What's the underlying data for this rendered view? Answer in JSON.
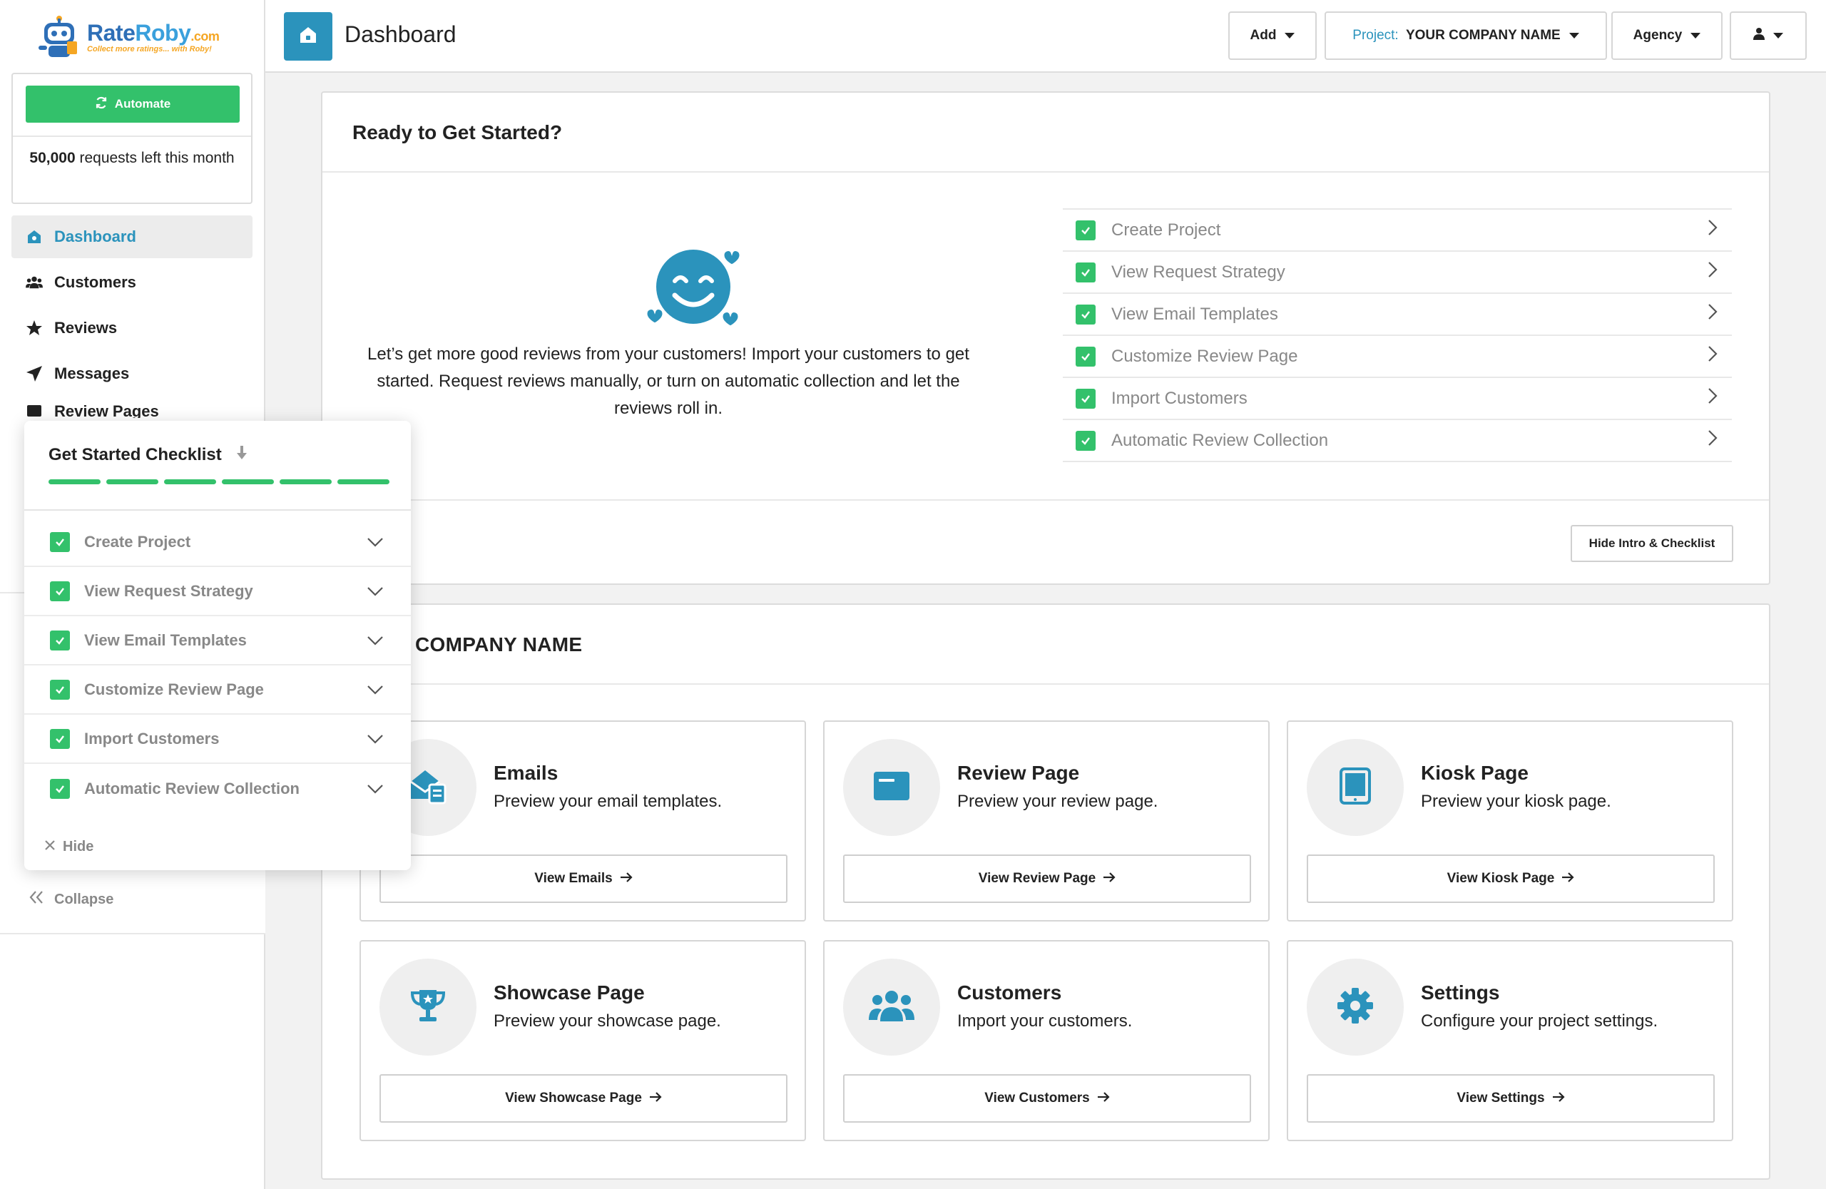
{
  "brand": {
    "name_part1": "Rate",
    "name_part2": "Roby",
    "name_suffix": ".com",
    "tagline": "Collect more ratings... with Roby!"
  },
  "automate": {
    "button_label": "Automate",
    "requests_count": "50,000",
    "requests_text": " requests left this month"
  },
  "sidebar": {
    "items": [
      {
        "label": "Dashboard",
        "icon": "home-icon",
        "active": true
      },
      {
        "label": "Customers",
        "icon": "users-icon"
      },
      {
        "label": "Reviews",
        "icon": "star-icon"
      },
      {
        "label": "Messages",
        "icon": "paper-plane-icon"
      },
      {
        "label": "Review Pages",
        "icon": "pages-icon"
      }
    ],
    "collapse_label": "Collapse"
  },
  "header": {
    "title": "Dashboard",
    "add_label": "Add",
    "project_prefix": "Project:",
    "project_name": "YOUR COMPANY NAME",
    "agency_label": "Agency"
  },
  "intro": {
    "title": "Ready to Get Started?",
    "body": "Let’s get more good reviews from your customers! Import your customers to get started. Request reviews manually, or turn on automatic collection and let the reviews roll in.",
    "checklist": [
      "Create Project",
      "View Request Strategy",
      "View Email Templates",
      "Customize Review Page",
      "Import Customers",
      "Automatic Review Collection"
    ],
    "hide_button": "Hide Intro & Checklist"
  },
  "project": {
    "title_visible": "COMPANY NAME",
    "features": [
      {
        "title": "Emails",
        "desc": "Preview your email templates.",
        "button": "View Emails",
        "icon": "envelope-icon"
      },
      {
        "title": "Review Page",
        "desc": "Preview your review page.",
        "button": "View Review Page",
        "icon": "browser-window-icon"
      },
      {
        "title": "Kiosk Page",
        "desc": "Preview your kiosk page.",
        "button": "View Kiosk Page",
        "icon": "tablet-icon"
      },
      {
        "title": "Showcase Page",
        "desc": "Preview your showcase page.",
        "button": "View Showcase Page",
        "icon": "trophy-icon"
      },
      {
        "title": "Customers",
        "desc": "Import your customers.",
        "button": "View Customers",
        "icon": "users-icon"
      },
      {
        "title": "Settings",
        "desc": "Configure your project settings.",
        "button": "View Settings",
        "icon": "gear-icon"
      }
    ]
  },
  "popup": {
    "title": "Get Started Checklist",
    "progress_complete": 6,
    "progress_total": 6,
    "items": [
      "Create Project",
      "View Request Strategy",
      "View Email Templates",
      "Customize Review Page",
      "Import Customers",
      "Automatic Review Collection"
    ],
    "hide_label": "Hide"
  },
  "colors": {
    "accent": "#2b93bc",
    "success": "#33c16b",
    "brand_blue": "#2e6fb7",
    "brand_orange": "#f5a623"
  }
}
